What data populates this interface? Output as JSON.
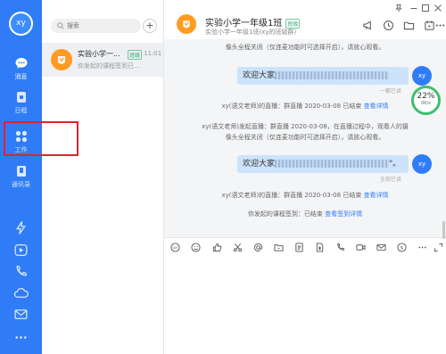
{
  "sidebar": {
    "avatar_text": "xy",
    "items": [
      {
        "label": "消息",
        "icon": "chat-bubble-icon"
      },
      {
        "label": "日程",
        "icon": "calendar-icon"
      },
      {
        "label": "工作",
        "icon": "grid-icon"
      },
      {
        "label": "通讯录",
        "icon": "contacts-icon"
      }
    ],
    "bottom_icons": [
      "lightning-icon",
      "play-icon",
      "phone-icon",
      "cloud-icon",
      "mail-icon",
      "more-icon"
    ]
  },
  "list": {
    "search_placeholder": "搜索",
    "add_label": "+",
    "conversation": {
      "name": "实验小学一...",
      "tag": "班级",
      "time": "11:01",
      "preview": "你发起的课程签到已..."
    }
  },
  "chat": {
    "title": "实验小学一年级1班",
    "tag": "班级",
    "subtitle": "实验小学一年级1班(xy的班级群)",
    "header_icons": [
      "megaphone-icon",
      "clock-icon",
      "folder-icon",
      "calendar-icon",
      "more-icon"
    ],
    "messages": [
      {
        "type": "system",
        "text": "像头全程关闭（仅连麦功能时可选择开启），请放心观看。"
      },
      {
        "type": "bubble",
        "text": "欢迎大家",
        "state": "一都已读",
        "avatar": "xy"
      },
      {
        "type": "system",
        "text": "xy(语文老师)的直播：群直播 2020-03-08 已结束",
        "link": "查看详情"
      },
      {
        "type": "system",
        "text": "xy(语文老师)发起直播：群直播 2020-03-08，在直播过程中，观看人的摄"
      },
      {
        "type": "system",
        "text": "像头全程关闭（仅连麦功能时可选择开启），请放心观看。"
      },
      {
        "type": "bubble",
        "text": "欢迎大家",
        "suffix": "\"。",
        "state": "全部已读",
        "avatar": "xy"
      },
      {
        "type": "system",
        "text": "xy(语文老师)的直播：群直播 2020-03-08 已结束",
        "link": "查看详情"
      },
      {
        "type": "system",
        "text": "你发起的课程签到：已结束",
        "link": "查看签到详情"
      }
    ],
    "speed_widget": {
      "percent": "22%",
      "rate": "0K/s"
    },
    "toolbar_icons": [
      "gif-icon",
      "emoji-icon",
      "thumbs-up-icon",
      "scissors-icon",
      "at-icon",
      "folder-icon",
      "doc-icon",
      "file-icon",
      "phone-icon",
      "video-icon",
      "mail-icon",
      "dollar-icon",
      "more-icon"
    ],
    "colors": {
      "brand": "#2f7cf6",
      "bubble": "#cde3fb",
      "highlight": "#d9262c"
    }
  }
}
